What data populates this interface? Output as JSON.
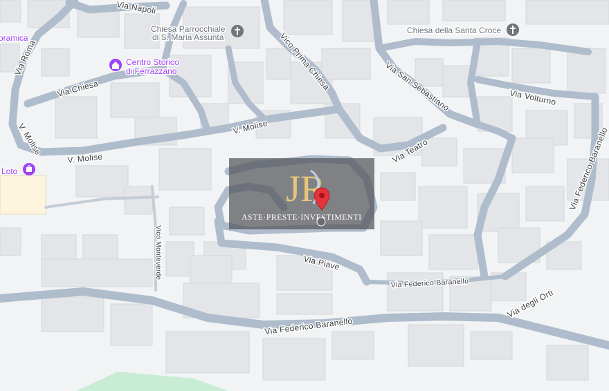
{
  "map": {
    "colors": {
      "background": "#f1f3f4",
      "building": "#e3e5e8",
      "building_stroke": "#d4d7dc",
      "road": "#aebccc",
      "road_edge": "#9fb0c2",
      "label": "#3c4043",
      "poi_purple": "#a142f4",
      "poi_gray": "#70757a",
      "pin_red": "#e5333a",
      "highlight_parcel": "#fdf5dd",
      "park_green": "#c9ecd5"
    },
    "street_labels": [
      {
        "id": "via-napoli",
        "text": "Via Napoli"
      },
      {
        "id": "via-roma",
        "text": "Via Roma"
      },
      {
        "id": "via-chiesa",
        "text": "Via Chiesa"
      },
      {
        "id": "vico-prima-chiesa",
        "text": "Vico Prima Chiesa"
      },
      {
        "id": "via-san-sebastiano",
        "text": "Via San Sebastiano"
      },
      {
        "id": "via-volturno",
        "text": "Via Volturno"
      },
      {
        "id": "v-molise-top",
        "text": "V. Molise"
      },
      {
        "id": "v-molise-left",
        "text": "V. Molise"
      },
      {
        "id": "v-molise-bottom",
        "text": "V. Molise"
      },
      {
        "id": "via-teatro",
        "text": "Via Teatro"
      },
      {
        "id": "via-federico-baranello-right",
        "text": "Via Federico Baranello"
      },
      {
        "id": "vico-monteverde",
        "text": "Vico Monteverde"
      },
      {
        "id": "via-piave",
        "text": "Via Piave"
      },
      {
        "id": "via-federico-baranello-mid",
        "text": "Via Federico Baranello"
      },
      {
        "id": "via-federico-baranello-bottom",
        "text": "Via Federico Baranello"
      },
      {
        "id": "via-degli-orti",
        "text": "Via degli Orti"
      }
    ],
    "pois": {
      "chiesa_parrocchiale": {
        "line1": "Chiesa Parrocchiale",
        "line2": "di S. Maria Assunta",
        "icon": "church-icon"
      },
      "chiesa_santa_croce": {
        "label": "Chiesa della Santa Croce",
        "icon": "church-icon"
      },
      "centro_storico": {
        "line1": "Centro Storico",
        "line2": "di Ferrazzano",
        "icon": "landmark-icon"
      },
      "loto": {
        "label": "Loto",
        "icon": "shopping-icon"
      },
      "ceramica_partial": {
        "label": "oramica"
      }
    },
    "watermark": {
      "monogram": "JR",
      "tagline": "ASTE·PRESTE·INVESTIMENTI"
    },
    "marker": {
      "icon": "location-pin-icon"
    }
  }
}
